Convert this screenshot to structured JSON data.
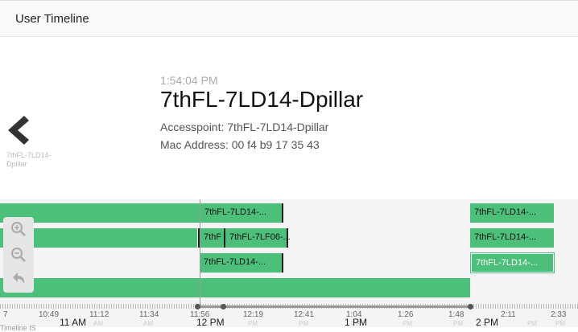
{
  "header": {
    "title": "User Timeline"
  },
  "detail": {
    "time": "1:54:04 PM",
    "title": "7thFL-7LD14-Dpillar",
    "accesspoint": "Accesspoint: 7thFL-7LD14-Dpillar",
    "mac": "Mac Address: 00 f4 b9 17 35 43",
    "prev_label": "7thFL-7LD14-Dpillar"
  },
  "timeline": {
    "bars": [
      {
        "label": "7thFL-7LD14-..."
      },
      {
        "label": "7thFL-7LD14-..."
      },
      {
        "label": "7thF"
      },
      {
        "label": "7thFL-7LF06-..."
      },
      {
        "label": "7thFL-7LD14-..."
      },
      {
        "label": "7thFL-7LD14-..."
      },
      {
        "label": "7thFL-7LD14-..."
      }
    ],
    "axis_ticks": [
      {
        "time": "7",
        "sub": ""
      },
      {
        "time": "10:49",
        "sub": "AM"
      },
      {
        "time": "11:12",
        "sub": "AM"
      },
      {
        "time": "11:34",
        "sub": "AM"
      },
      {
        "time": "11:56",
        "sub": ""
      },
      {
        "time": "12:19",
        "sub": "PM"
      },
      {
        "time": "12:41",
        "sub": "PM"
      },
      {
        "time": "1:04",
        "sub": "PM"
      },
      {
        "time": "1:26",
        "sub": "PM"
      },
      {
        "time": "1:48",
        "sub": "PM"
      },
      {
        "time": "2:11",
        "sub": "PM"
      },
      {
        "time": "2:33",
        "sub": "PM"
      }
    ],
    "hour_labels": [
      "11 AM",
      "12 PM",
      "1 PM",
      "2 PM"
    ],
    "axis_label": "Timeline IS",
    "colors": {
      "bar": "#4cc07b",
      "selected_label": "#ffffff"
    }
  }
}
